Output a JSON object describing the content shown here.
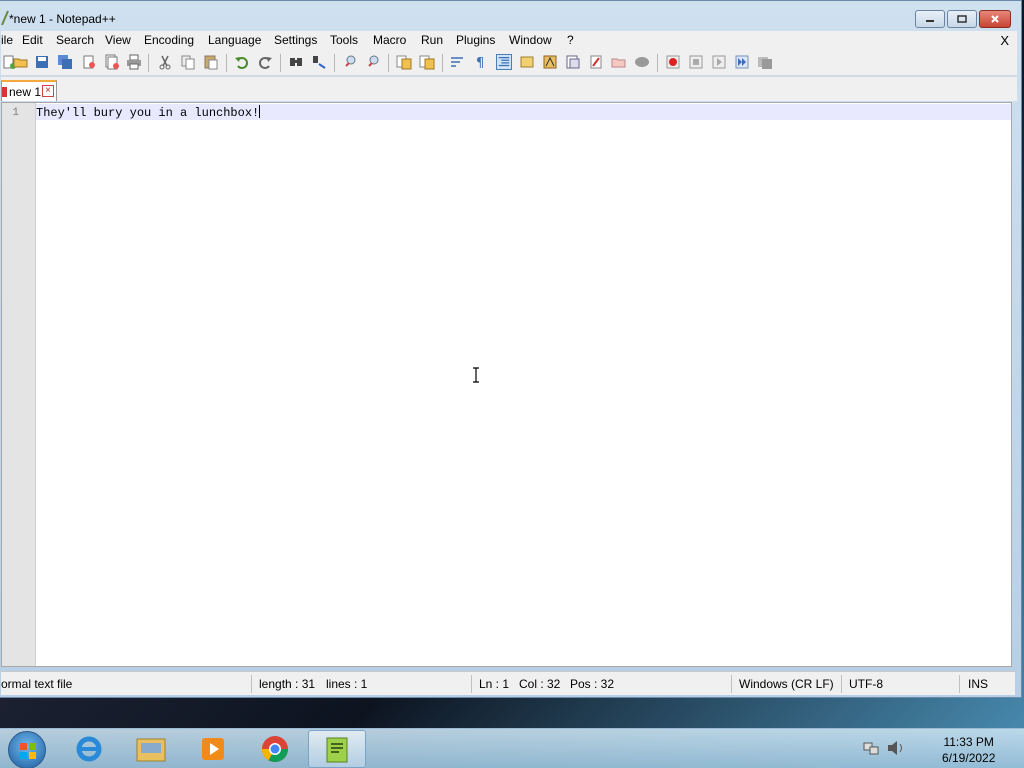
{
  "window": {
    "title": "*new 1 - Notepad++",
    "menu_close": "X"
  },
  "menu": [
    "ile",
    "Edit",
    "Search",
    "View",
    "Encoding",
    "Language",
    "Settings",
    "Tools",
    "Macro",
    "Run",
    "Plugins",
    "Window",
    "?"
  ],
  "toolbar_icons": [
    "new-file-icon",
    "open-file-icon",
    "save-icon",
    "save-all-icon",
    "close-icon",
    "close-all-icon",
    "print-icon",
    "cut-icon",
    "copy-icon",
    "paste-icon",
    "undo-icon",
    "redo-icon",
    "find-icon",
    "replace-icon",
    "zoom-in-icon",
    "zoom-out-icon",
    "sync-vertical-icon",
    "sync-horizontal-icon",
    "word-wrap-icon",
    "show-all-chars-icon",
    "indent-guide-icon",
    "udl-icon",
    "document-map-icon",
    "function-list-icon",
    "folder-as-workspace-icon",
    "monitoring-icon",
    "spellcheck-icon",
    "record-macro-icon",
    "stop-macro-icon",
    "play-macro-icon",
    "run-macro-multiple-icon",
    "save-macro-icon"
  ],
  "tab": {
    "label": "new 1",
    "close": "×"
  },
  "editor": {
    "line_number": "1",
    "text": "They'll bury you in a lunchbox!"
  },
  "status": {
    "file_type": "ormal text file",
    "length": "length : 31",
    "lines": "lines : 1",
    "ln": "Ln : 1",
    "col": "Col : 32",
    "pos": "Pos : 32",
    "eol": "Windows (CR LF)",
    "encoding": "UTF-8",
    "mode": "INS"
  },
  "taskbar": {
    "apps": [
      "internet-explorer-icon",
      "file-explorer-icon",
      "media-player-icon",
      "chrome-icon",
      "notepad-plus-plus-icon"
    ],
    "time": "11:33 PM",
    "date": "6/19/2022"
  }
}
